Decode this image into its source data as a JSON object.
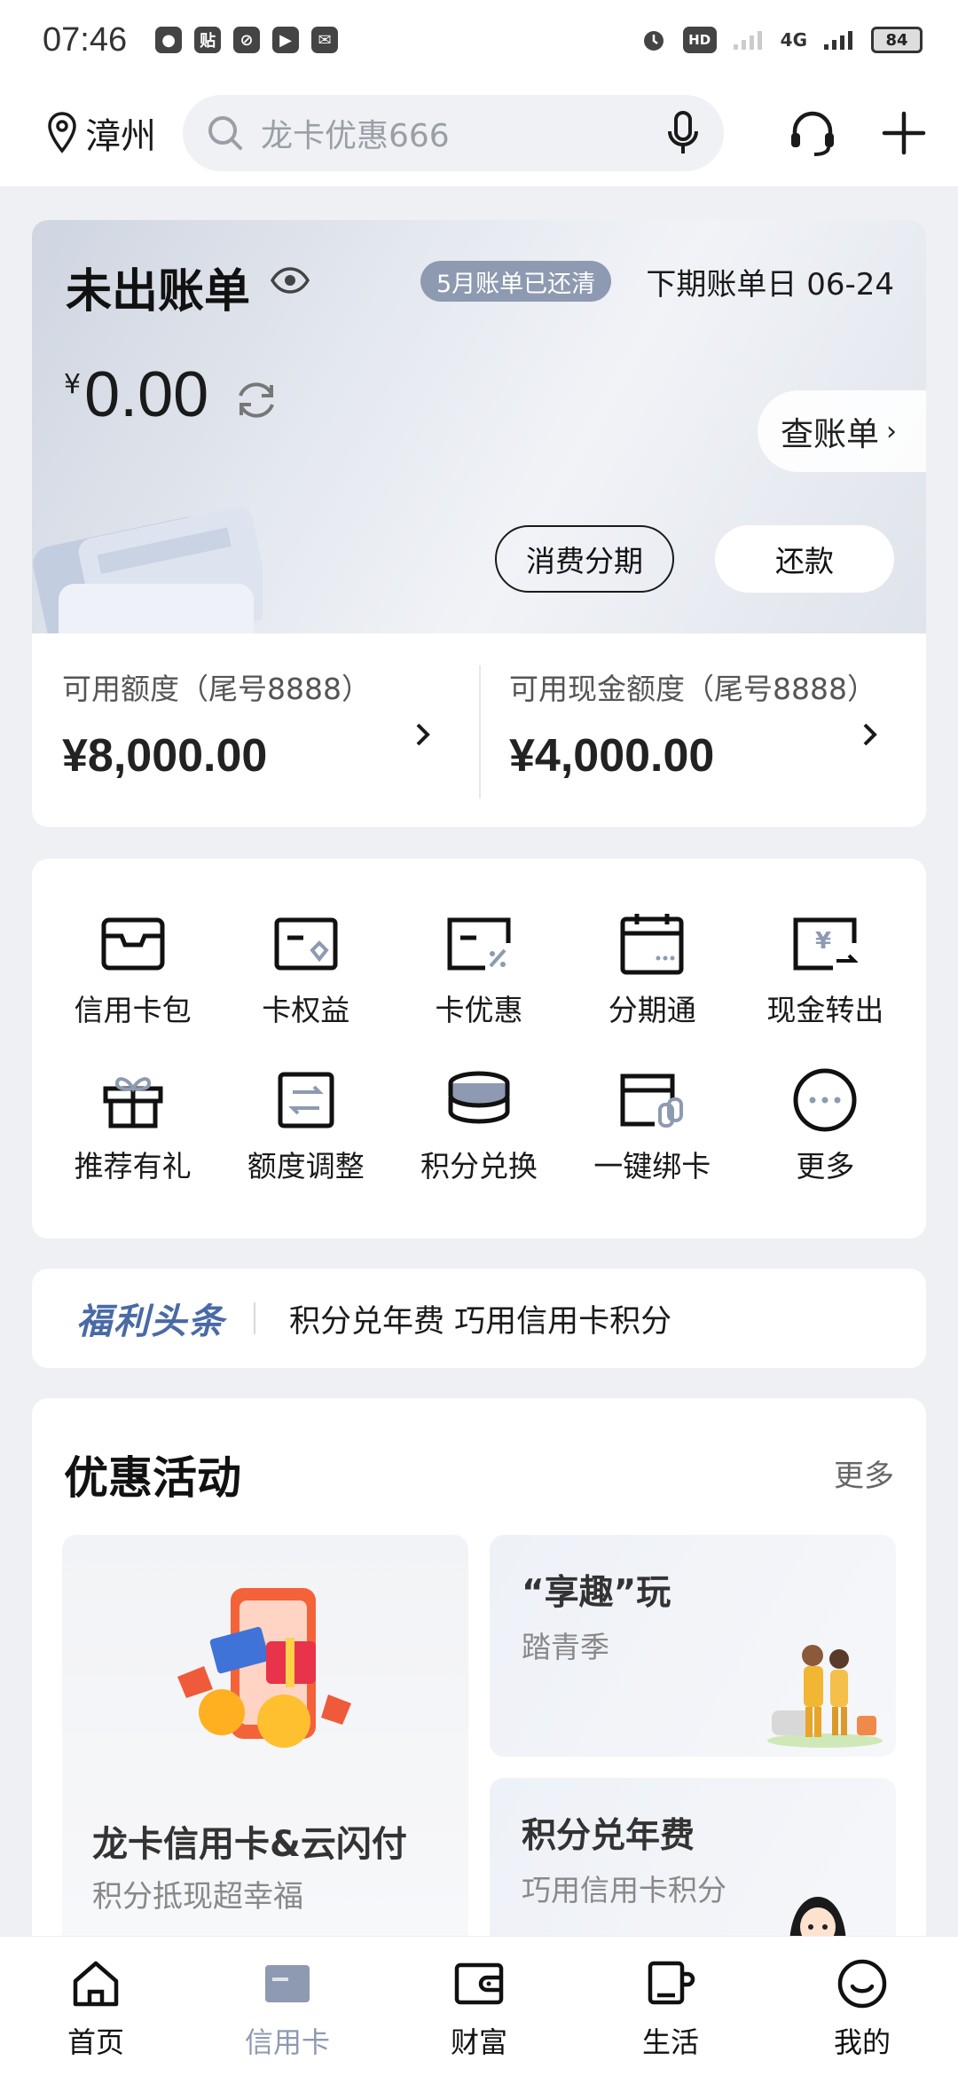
{
  "status_bar": {
    "time": "07:46",
    "app_icons": [
      "baidu-app-icon",
      "tieba-app-icon",
      "link-app-icon",
      "video-app-icon",
      "mail-app-icon"
    ],
    "network": "4G",
    "battery": "84"
  },
  "header": {
    "city": "漳州",
    "search_placeholder": "龙卡优惠666"
  },
  "bill": {
    "title": "未出账单",
    "paid_badge": "5月账单已还清",
    "next_bill_date": "下期账单日 06-24",
    "amount_symbol": "¥",
    "amount": "0.00",
    "check_bill": "查账单",
    "installment_button": "消费分期",
    "repay_button": "还款",
    "credit_limit_label": "可用额度（尾号8888）",
    "credit_limit_value": "¥8,000.00",
    "cash_limit_label": "可用现金额度（尾号8888）",
    "cash_limit_value": "¥4,000.00"
  },
  "functions": [
    {
      "label": "信用卡包",
      "icon": "card-wallet-icon"
    },
    {
      "label": "卡权益",
      "icon": "card-benefits-icon"
    },
    {
      "label": "卡优惠",
      "icon": "card-discount-icon"
    },
    {
      "label": "分期通",
      "icon": "installment-calendar-icon"
    },
    {
      "label": "现金转出",
      "icon": "cash-transfer-icon"
    },
    {
      "label": "推荐有礼",
      "icon": "gift-icon"
    },
    {
      "label": "额度调整",
      "icon": "limit-adjust-icon"
    },
    {
      "label": "积分兑换",
      "icon": "points-coins-icon"
    },
    {
      "label": "一键绑卡",
      "icon": "bind-card-icon"
    },
    {
      "label": "更多",
      "icon": "more-dots-icon"
    }
  ],
  "news": {
    "tag": "福利头条",
    "text": "积分兑年费 巧用信用卡积分"
  },
  "promotions": {
    "title": "优惠活动",
    "more": "更多",
    "main": {
      "title": "龙卡信用卡&云闪付",
      "subtitle": "积分抵现超幸福"
    },
    "side_a": {
      "title": "“享趣”玩",
      "subtitle": "踏青季"
    },
    "side_b": {
      "title": "积分兑年费",
      "subtitle": "巧用信用卡积分"
    }
  },
  "bottom_nav": [
    {
      "label": "首页",
      "icon": "home-icon",
      "active": false
    },
    {
      "label": "信用卡",
      "icon": "credit-card-icon",
      "active": true
    },
    {
      "label": "财富",
      "icon": "wallet-icon",
      "active": false
    },
    {
      "label": "生活",
      "icon": "cup-icon",
      "active": false
    },
    {
      "label": "我的",
      "icon": "smiley-icon",
      "active": false
    }
  ],
  "colors": {
    "accent": "#8e9ab2",
    "news_tag": "#4a6aa6",
    "background": "#eef0f3"
  }
}
